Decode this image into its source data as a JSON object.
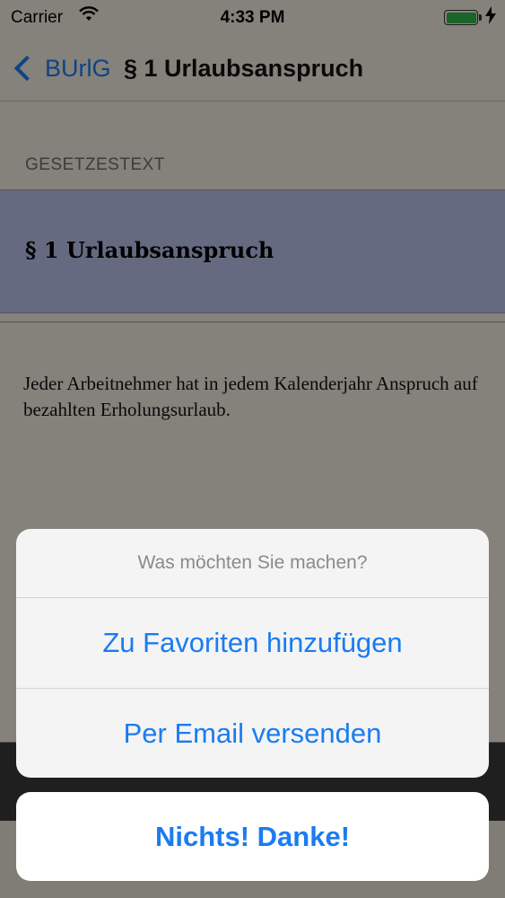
{
  "status_bar": {
    "carrier": "Carrier",
    "time": "4:33 PM",
    "battery_color": "#2fb84a"
  },
  "nav": {
    "back_label": "BUrlG",
    "title": "§ 1 Urlaubsanspruch"
  },
  "content": {
    "section_header": "GESETZESTEXT",
    "heading": "§ 1 Urlaubsanspruch",
    "body": "Jeder Arbeitnehmer hat in jedem Kalenderjahr Anspruch auf bezahlten Erholungsurlaub."
  },
  "action_sheet": {
    "title": "Was möchten Sie machen?",
    "buttons": [
      {
        "label": "Zu Favoriten hinzufügen"
      },
      {
        "label": "Per Email versenden"
      }
    ],
    "cancel_label": "Nichts! Danke!"
  },
  "colors": {
    "accent": "#1a7cf0",
    "heading_bg": "#b9c2ec"
  },
  "icons": [
    "wifi-icon",
    "battery-icon",
    "charging-icon",
    "chevron-left-icon"
  ]
}
